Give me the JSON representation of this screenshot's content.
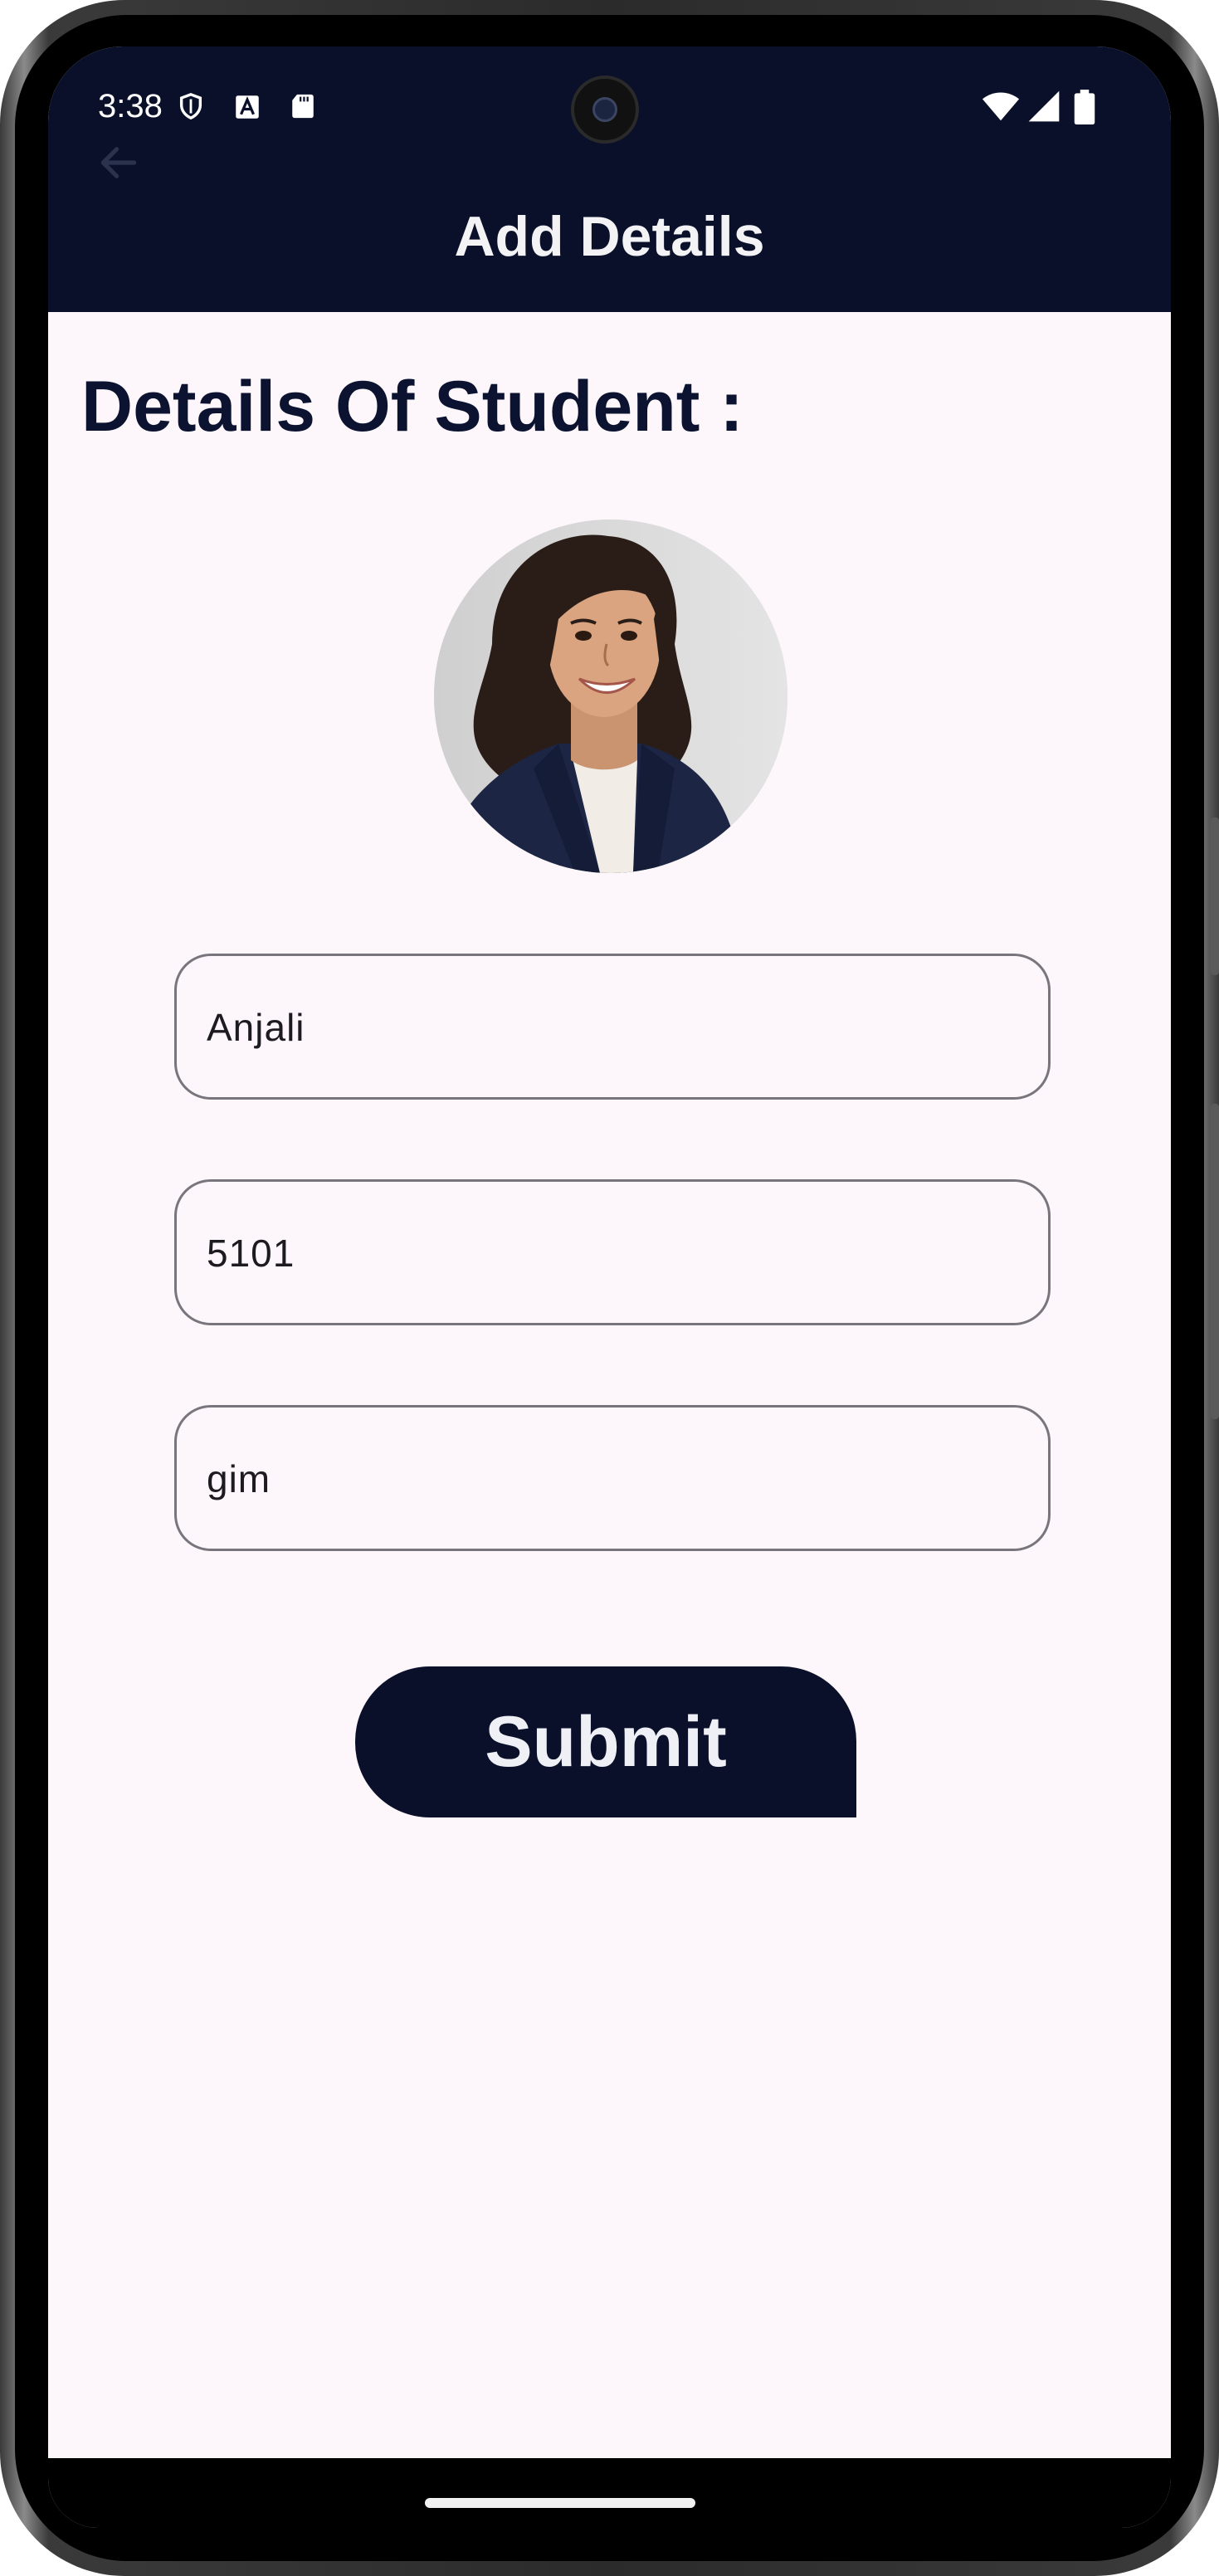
{
  "status_bar": {
    "time": "3:38",
    "icons": [
      "shield-icon",
      "font-a-icon",
      "sd-card-icon",
      "wifi-icon",
      "signal-icon",
      "battery-icon"
    ]
  },
  "app_bar": {
    "title": "Add Details",
    "back_icon": "arrow-back-icon"
  },
  "main": {
    "section_title": "Details Of Student :",
    "avatar_icon": "student-photo",
    "fields": [
      {
        "value": "Anjali"
      },
      {
        "value": "5101"
      },
      {
        "value": "gim"
      }
    ],
    "submit_label": "Submit"
  },
  "colors": {
    "app_bar_bg": "#0a1029",
    "screen_bg": "#fdf7fb",
    "title_text": "#0c1330",
    "field_border": "#78757d"
  }
}
